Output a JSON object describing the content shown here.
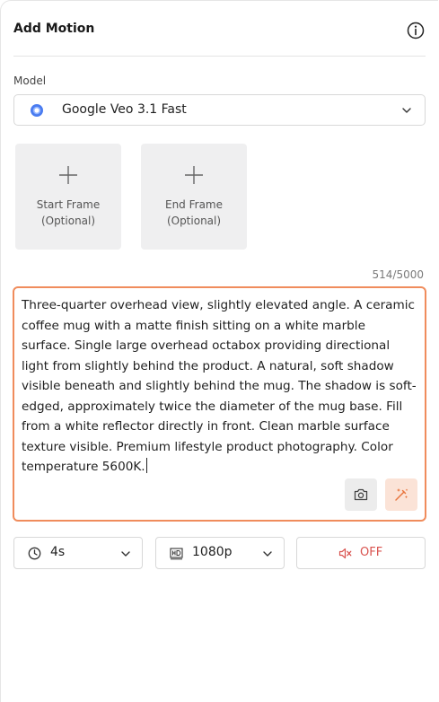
{
  "header": {
    "title": "Add Motion",
    "info_icon": "info-icon"
  },
  "model": {
    "label": "Model",
    "selected": "Google Veo 3.1 Fast",
    "logo_icon": "google-veo-logo-icon"
  },
  "frames": {
    "start": {
      "line1": "Start Frame",
      "line2": "(Optional)",
      "icon": "plus-icon"
    },
    "end": {
      "line1": "End Frame",
      "line2": "(Optional)",
      "icon": "plus-icon"
    }
  },
  "prompt": {
    "char_count": "514/5000",
    "text": "Three-quarter overhead view, slightly elevated angle. A ceramic coffee mug with a matte finish sitting on a white marble surface. Single large overhead octabox providing directional light from slightly behind the product. A natural, soft shadow visible beneath and slightly behind the mug. The shadow is soft-edged, approximately twice the diameter of the mug base. Fill from a white reflector directly in front. Clean marble surface texture visible. Premium lifestyle product photography. Color temperature 5600K."
  },
  "controls": {
    "duration": {
      "value": "4s",
      "icon": "clock-icon"
    },
    "resolution": {
      "value": "1080p",
      "icon": "hd-icon"
    },
    "audio": {
      "value": "OFF",
      "icon": "speaker-muted-icon"
    }
  },
  "colors": {
    "accent_border": "#f08c5c",
    "enhance_bg": "#fbe3d7",
    "audio_off": "#d9534f",
    "tile_bg": "#efeff0"
  }
}
